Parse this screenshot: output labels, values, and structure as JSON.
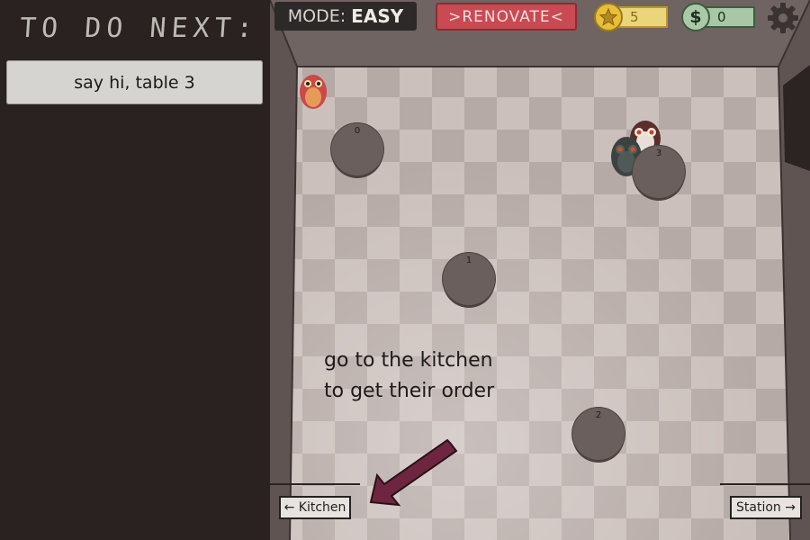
{
  "sidebar": {
    "title": "TO DO NEXT:",
    "tasks": [
      "say hi, table 3"
    ]
  },
  "topbar": {
    "mode_label": "MODE:",
    "mode_value": "EASY",
    "renovate_label": ">RENOVATE<",
    "stars": "5",
    "cash_symbol": "$",
    "cash": "0"
  },
  "room": {
    "tables": [
      {
        "number": "0"
      },
      {
        "number": "3"
      },
      {
        "number": "1"
      },
      {
        "number": "2"
      }
    ],
    "hint": "go to the kitchen\nto get their order",
    "kitchen_label": "← Kitchen",
    "station_label": "Station →"
  },
  "colors": {
    "renovate": "#c94a52",
    "star": "#e7bf38",
    "cash": "#a9caa6",
    "arrow": "#6e2640"
  },
  "icons": [
    "star-icon",
    "dollar-icon",
    "gear-icon",
    "owl-player",
    "owl-customer",
    "arrow-icon"
  ]
}
